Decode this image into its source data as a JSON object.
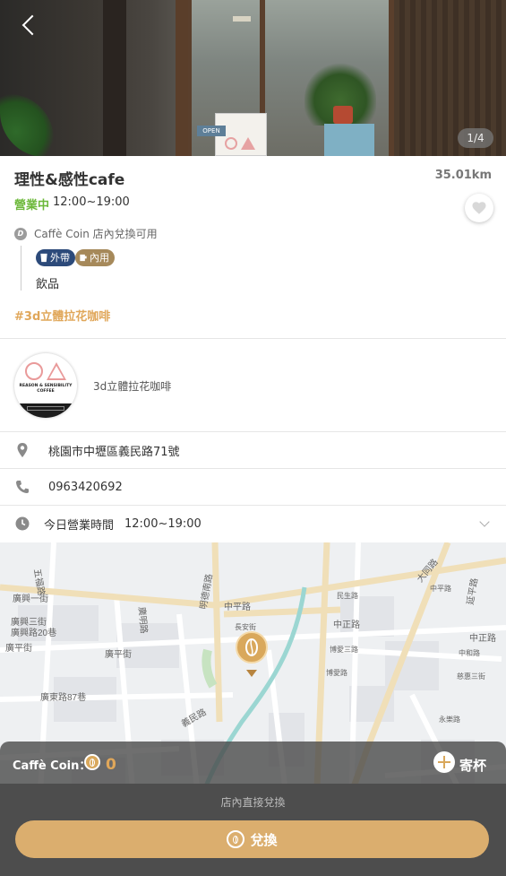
{
  "hero": {
    "page_counter": "1/4",
    "sign_text": "OPEN"
  },
  "shop": {
    "name": "理性&感性cafe",
    "distance": "35.01km",
    "status": "營業中",
    "hours": "12:00~19:00",
    "coin_label": "Caffè Coin 店內兌換可用",
    "tags": {
      "takeout": "外帶",
      "dine_in": "內用"
    },
    "item": "飲品",
    "hashtag": "#3d立體拉花咖啡",
    "description": "3d立體拉花咖啡",
    "logo_text": "REASON & SENSIBILITY COFFEE"
  },
  "info": {
    "address": "桃園市中壢區義民路71號",
    "phone": "0963420692",
    "today_label": "今日營業時間",
    "today_hours": "12:00~19:00"
  },
  "map": {
    "labels": [
      "五福路",
      "廣興一街",
      "廣興三街",
      "廣興路20巷",
      "廣平街",
      "廣東路87巷",
      "廣平街",
      "中平路",
      "廣明路",
      "明德南路",
      "義民路",
      "中正路",
      "長安街",
      "中正路",
      "民生路",
      "博愛三路",
      "博愛路",
      "大同路",
      "中平路",
      "延平路",
      "中正路",
      "中和路",
      "慈惠三街",
      "永樂路"
    ]
  },
  "bottom": {
    "coin_label": "Caffè Coin：",
    "coin_value": "0",
    "send_label": "寄杯",
    "panel_label": "店內直接兌換",
    "redeem_label": "兌換"
  }
}
